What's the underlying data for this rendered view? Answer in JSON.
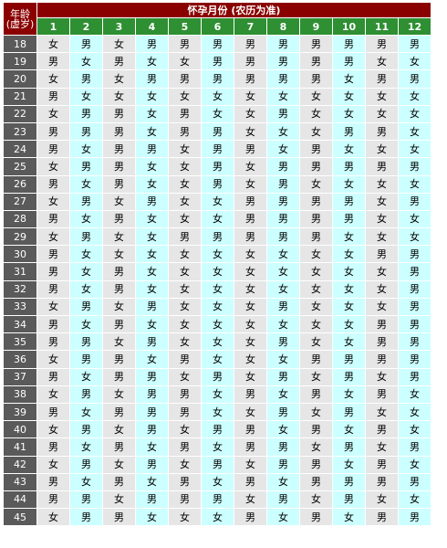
{
  "header": {
    "age_label": "年龄(虚岁)",
    "title": "怀孕月份 (农历为准)"
  },
  "months": [
    "1",
    "2",
    "3",
    "4",
    "5",
    "6",
    "7",
    "8",
    "9",
    "10",
    "11",
    "12"
  ],
  "legend": {
    "boy": "男",
    "girl": "女"
  },
  "colors": {
    "title_bg": "#8a0000",
    "month_bg": "#2e8f33",
    "age_bg": "#5a5a5a",
    "boy_bg": "#ccffff",
    "girl_bg": "#e6e6e6"
  },
  "rows": [
    {
      "age": "18",
      "cells": [
        "女",
        "男",
        "女",
        "男",
        "男",
        "男",
        "男",
        "男",
        "男",
        "男",
        "男",
        "男"
      ]
    },
    {
      "age": "19",
      "cells": [
        "男",
        "女",
        "男",
        "女",
        "女",
        "男",
        "男",
        "男",
        "男",
        "男",
        "女",
        "女"
      ]
    },
    {
      "age": "20",
      "cells": [
        "女",
        "男",
        "女",
        "男",
        "男",
        "男",
        "男",
        "男",
        "男",
        "女",
        "男",
        "男"
      ]
    },
    {
      "age": "21",
      "cells": [
        "男",
        "女",
        "女",
        "女",
        "女",
        "女",
        "女",
        "女",
        "女",
        "女",
        "女",
        "女"
      ]
    },
    {
      "age": "22",
      "cells": [
        "女",
        "男",
        "男",
        "女",
        "男",
        "女",
        "女",
        "男",
        "女",
        "女",
        "女",
        "女"
      ]
    },
    {
      "age": "23",
      "cells": [
        "男",
        "男",
        "男",
        "女",
        "男",
        "男",
        "女",
        "女",
        "女",
        "男",
        "男",
        "女"
      ]
    },
    {
      "age": "24",
      "cells": [
        "男",
        "女",
        "男",
        "男",
        "女",
        "男",
        "男",
        "女",
        "男",
        "女",
        "女",
        "女"
      ]
    },
    {
      "age": "25",
      "cells": [
        "女",
        "男",
        "男",
        "女",
        "女",
        "男",
        "女",
        "男",
        "男",
        "男",
        "男",
        "男"
      ]
    },
    {
      "age": "26",
      "cells": [
        "男",
        "女",
        "男",
        "女",
        "女",
        "男",
        "女",
        "男",
        "女",
        "女",
        "女",
        "女"
      ]
    },
    {
      "age": "27",
      "cells": [
        "女",
        "男",
        "女",
        "男",
        "女",
        "女",
        "男",
        "男",
        "男",
        "男",
        "女",
        "男"
      ]
    },
    {
      "age": "28",
      "cells": [
        "男",
        "女",
        "男",
        "女",
        "女",
        "女",
        "男",
        "男",
        "男",
        "男",
        "女",
        "女"
      ]
    },
    {
      "age": "29",
      "cells": [
        "女",
        "男",
        "女",
        "女",
        "男",
        "男",
        "男",
        "男",
        "男",
        "女",
        "女",
        "女"
      ]
    },
    {
      "age": "30",
      "cells": [
        "男",
        "女",
        "女",
        "女",
        "女",
        "女",
        "女",
        "女",
        "女",
        "女",
        "男",
        "男"
      ]
    },
    {
      "age": "31",
      "cells": [
        "男",
        "女",
        "男",
        "女",
        "女",
        "女",
        "女",
        "女",
        "女",
        "女",
        "女",
        "男"
      ]
    },
    {
      "age": "32",
      "cells": [
        "男",
        "女",
        "男",
        "女",
        "女",
        "女",
        "女",
        "女",
        "女",
        "女",
        "女",
        "男"
      ]
    },
    {
      "age": "33",
      "cells": [
        "女",
        "男",
        "女",
        "男",
        "女",
        "女",
        "女",
        "男",
        "女",
        "女",
        "女",
        "男"
      ]
    },
    {
      "age": "34",
      "cells": [
        "男",
        "女",
        "男",
        "女",
        "女",
        "女",
        "女",
        "女",
        "女",
        "女",
        "男",
        "男"
      ]
    },
    {
      "age": "35",
      "cells": [
        "男",
        "男",
        "女",
        "男",
        "女",
        "女",
        "女",
        "男",
        "女",
        "女",
        "男",
        "男"
      ]
    },
    {
      "age": "36",
      "cells": [
        "女",
        "男",
        "男",
        "女",
        "男",
        "女",
        "女",
        "女",
        "男",
        "男",
        "男",
        "男"
      ]
    },
    {
      "age": "37",
      "cells": [
        "男",
        "女",
        "男",
        "男",
        "女",
        "男",
        "女",
        "男",
        "女",
        "男",
        "女",
        "男"
      ]
    },
    {
      "age": "38",
      "cells": [
        "女",
        "男",
        "女",
        "男",
        "男",
        "女",
        "男",
        "女",
        "男",
        "女",
        "男",
        "女"
      ]
    },
    {
      "age": "39",
      "cells": [
        "男",
        "女",
        "男",
        "男",
        "男",
        "女",
        "女",
        "男",
        "女",
        "男",
        "女",
        "女"
      ]
    },
    {
      "age": "40",
      "cells": [
        "女",
        "男",
        "女",
        "男",
        "女",
        "男",
        "男",
        "女",
        "男",
        "女",
        "男",
        "女"
      ]
    },
    {
      "age": "41",
      "cells": [
        "男",
        "女",
        "男",
        "女",
        "男",
        "女",
        "男",
        "男",
        "女",
        "男",
        "女",
        "男"
      ]
    },
    {
      "age": "42",
      "cells": [
        "女",
        "男",
        "女",
        "男",
        "女",
        "男",
        "女",
        "男",
        "男",
        "女",
        "男",
        "女"
      ]
    },
    {
      "age": "43",
      "cells": [
        "男",
        "女",
        "男",
        "女",
        "男",
        "女",
        "男",
        "女",
        "男",
        "男",
        "男",
        "男"
      ]
    },
    {
      "age": "44",
      "cells": [
        "男",
        "男",
        "女",
        "男",
        "男",
        "男",
        "女",
        "男",
        "女",
        "男",
        "女",
        "女"
      ]
    },
    {
      "age": "45",
      "cells": [
        "女",
        "男",
        "男",
        "女",
        "女",
        "女",
        "男",
        "女",
        "男",
        "女",
        "男",
        "男"
      ]
    }
  ]
}
